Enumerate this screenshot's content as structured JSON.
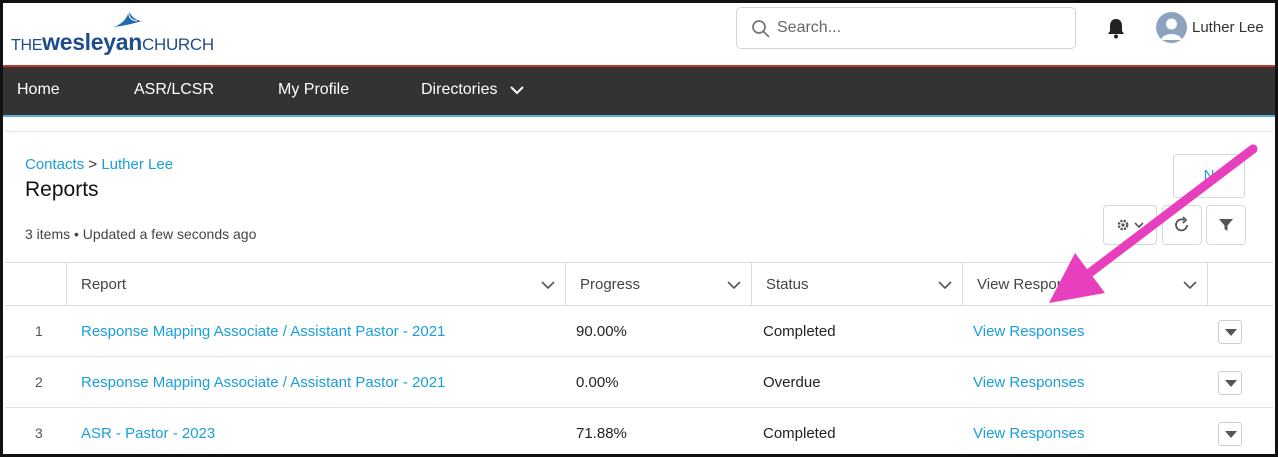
{
  "header": {
    "logo": {
      "the": "THE",
      "brand": "wesleyan",
      "church": "CHURCH"
    },
    "search": {
      "placeholder": "Search..."
    },
    "user": {
      "name": "Luther Lee"
    }
  },
  "nav": {
    "items": [
      {
        "label": "Home"
      },
      {
        "label": "ASR/LCSR"
      },
      {
        "label": "My Profile"
      },
      {
        "label": "Directories"
      }
    ]
  },
  "page": {
    "breadcrumb": {
      "parent": "Contacts",
      "separator": ">",
      "current": "Luther Lee"
    },
    "title": "Reports",
    "meta": "3 items • Updated a few seconds ago",
    "new_button": "N"
  },
  "table": {
    "columns": [
      "Report",
      "Progress",
      "Status",
      "View Respon"
    ],
    "rows": [
      {
        "index": "1",
        "report": "Response Mapping Associate / Assistant Pastor - 2021",
        "progress": "90.00%",
        "status": "Completed",
        "view": "View Responses"
      },
      {
        "index": "2",
        "report": "Response Mapping Associate / Assistant Pastor - 2021",
        "progress": "0.00%",
        "status": "Overdue",
        "view": "View Responses"
      },
      {
        "index": "3",
        "report": "ASR - Pastor - 2023",
        "progress": "71.88%",
        "status": "Completed",
        "view": "View Responses"
      }
    ]
  },
  "colors": {
    "link": "#1a9fd9",
    "nav_bg": "#333333",
    "brand_blue": "#1f4e8c",
    "annotation_arrow": "#e83fbf"
  },
  "icons": [
    "search-icon",
    "bell-icon",
    "avatar-icon",
    "chevron-down-icon",
    "gear-icon",
    "refresh-icon",
    "filter-icon",
    "caret-down-icon",
    "annotation-arrow"
  ]
}
